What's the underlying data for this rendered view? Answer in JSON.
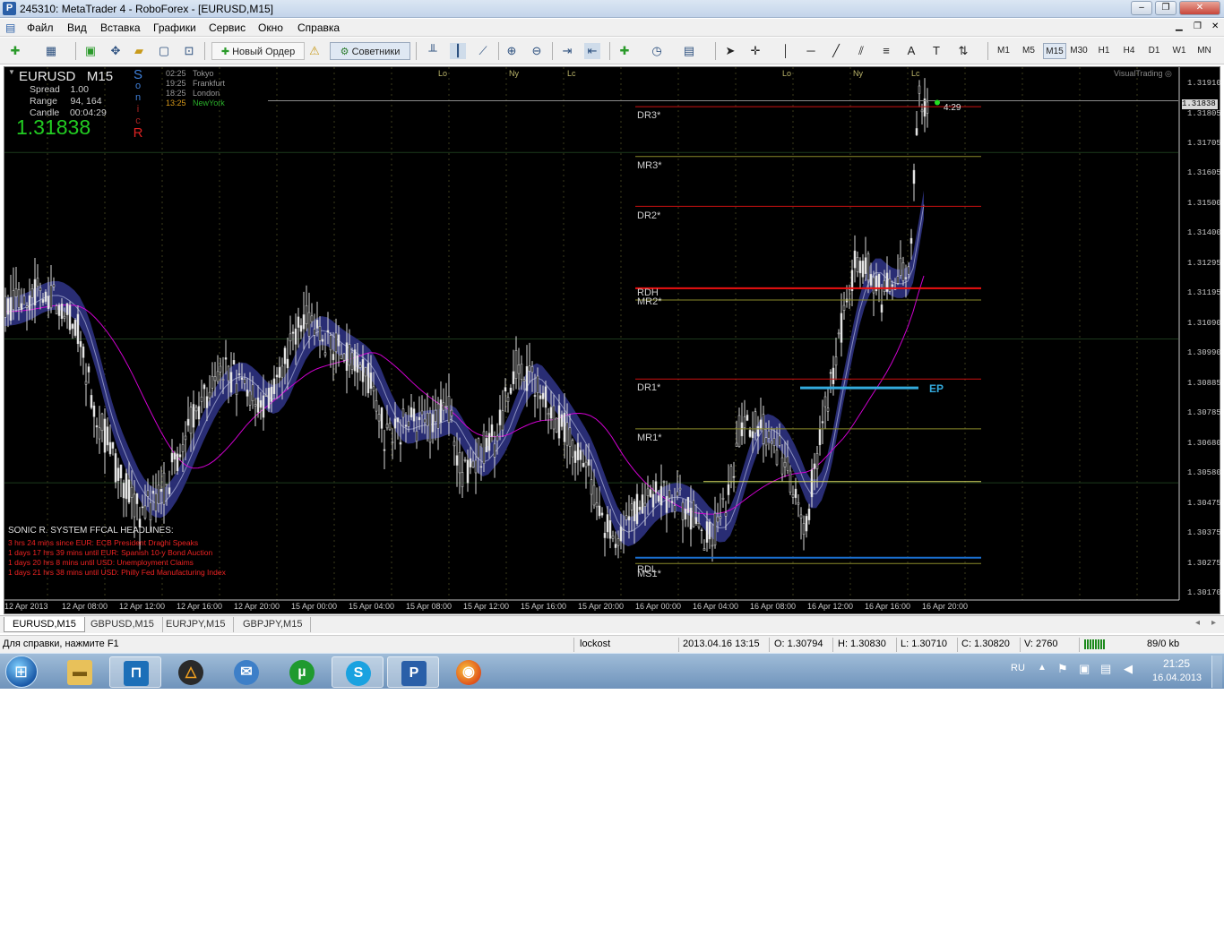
{
  "window": {
    "title": "245310: MetaTrader 4 - RoboForex - [EURUSD,M15]",
    "controls": [
      "–",
      "❐",
      "✕"
    ]
  },
  "menu": [
    "Файл",
    "Вид",
    "Вставка",
    "Графики",
    "Сервис",
    "Окно",
    "Справка"
  ],
  "toolbar": {
    "new_order": "Новый Ордер",
    "experts": "Советники",
    "timeframes": [
      "M1",
      "M5",
      "M15",
      "M30",
      "H1",
      "H4",
      "D1",
      "W1",
      "MN"
    ],
    "active_timeframe": "M15"
  },
  "chart": {
    "symbol": "EURUSD",
    "timeframe": "M15",
    "spread": "Spread    1.00",
    "range": "Range     94, 164",
    "candle": "Candle    00:04:29",
    "price": "1.31838",
    "sonic_letters": [
      "S",
      "o",
      "n",
      "i",
      "c",
      "R"
    ],
    "sessions": [
      {
        "time": "02:25",
        "name": "Tokyo"
      },
      {
        "time": "19:25",
        "name": "Frankfurt"
      },
      {
        "time": "18:25",
        "name": "London"
      },
      {
        "time": "13:25",
        "name": "NewYork"
      }
    ],
    "watermark": "VisualTrading",
    "session_marks": [
      "Lo",
      "Ny",
      "Lc",
      "Lo",
      "Ny",
      "Lc"
    ],
    "levels": [
      "DR3*",
      "MR3*",
      "DR2*",
      "RDH",
      "MR2*",
      "DR1*",
      "MR1*",
      "RDL",
      "MS1*"
    ],
    "ep_label": "EP",
    "countdown": "4:29",
    "current_price_label": "1.31838",
    "y_axis": [
      "1.31910",
      "1.31805",
      "1.31705",
      "1.31605",
      "1.31500",
      "1.31400",
      "1.31295",
      "1.31195",
      "1.31090",
      "1.30990",
      "1.30885",
      "1.30785",
      "1.30680",
      "1.30580",
      "1.30475",
      "1.30375",
      "1.30275",
      "1.30170"
    ],
    "x_axis": [
      "12 Apr 2013",
      "12 Apr 08:00",
      "12 Apr 12:00",
      "12 Apr 16:00",
      "12 Apr 20:00",
      "15 Apr 00:00",
      "15 Apr 04:00",
      "15 Apr 08:00",
      "15 Apr 12:00",
      "15 Apr 16:00",
      "15 Apr 20:00",
      "16 Apr 00:00",
      "16 Apr 04:00",
      "16 Apr 08:00",
      "16 Apr 12:00",
      "16 Apr 16:00",
      "16 Apr 20:00"
    ],
    "headlines_title": "SONIC R. SYSTEM  FFCAL HEADLINES:",
    "headlines": [
      "3 hrs 24 mins since EUR: ECB President Draghi Speaks",
      "1 days 17 hrs 39 mins until EUR: Spanish 10-y Bond Auction",
      "1 days 20 hrs 8 mins until USD: Unemployment Claims",
      "1 days 21 hrs 38 mins until USD: Philly Fed Manufacturing Index"
    ],
    "colors": {
      "background": "#000000",
      "band": "#2b2f7a",
      "ma": "#d000d0",
      "ep_line": "#33aadd",
      "level_red": "#cc1111",
      "level_olive": "#8a8a2a"
    }
  },
  "chart_data": {
    "type": "candlestick",
    "title": "EURUSD M15",
    "ylim": [
      1.3017,
      1.3191
    ],
    "levels": [
      {
        "name": "DR3*",
        "value": 1.3183
      },
      {
        "name": "MR3*",
        "value": 1.3166
      },
      {
        "name": "DR2*",
        "value": 1.3149
      },
      {
        "name": "RDH",
        "value": 1.3121
      },
      {
        "name": "MR2*",
        "value": 1.3117
      },
      {
        "name": "DR1*",
        "value": 1.309
      },
      {
        "name": "MR1*",
        "value": 1.3073
      },
      {
        "name": "RDL",
        "value": 1.3029
      },
      {
        "name": "MS1*",
        "value": 1.3027
      }
    ],
    "ep": 1.3087,
    "last_price": 1.31838
  },
  "tabs": [
    "EURUSD,M15",
    "GBPUSD,M15",
    "EURJPY,M15",
    "GBPJPY,M15"
  ],
  "status": {
    "help": "Для справки, нажмите F1",
    "profile": "lockost",
    "datetime": "2013.04.16 13:15",
    "open": "O: 1.30794",
    "high": "H: 1.30830",
    "low": "L: 1.30710",
    "close": "C: 1.30820",
    "volume": "V: 2760",
    "traffic": "89/0 kb"
  },
  "taskbar": {
    "lang": "RU",
    "time": "21:25",
    "date": "16.04.2013"
  }
}
